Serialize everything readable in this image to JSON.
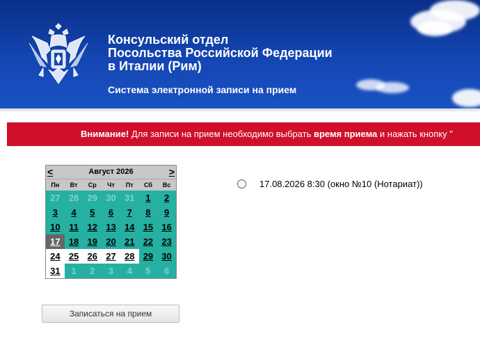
{
  "header": {
    "title_lines": [
      "Консульский отдел",
      "Посольства Российской Федерации",
      "в Италии (Рим)"
    ],
    "subtitle": "Система электронной записи на прием",
    "emblem_icon": "russian-coat-of-arms-icon"
  },
  "alert": {
    "bold_start": "Внимание!",
    "text1": " Для записи на прием необходимо выбрать ",
    "bold_mid": "время приема",
    "text2": " и нажать кнопку \""
  },
  "calendar": {
    "prev": "<",
    "next": ">",
    "month_title": "Август 2026",
    "weekdays": [
      "Пн",
      "Вт",
      "Ср",
      "Чт",
      "Пт",
      "Сб",
      "Вс"
    ],
    "days": [
      {
        "n": "27",
        "s": "dim"
      },
      {
        "n": "28",
        "s": "dim"
      },
      {
        "n": "29",
        "s": "dim"
      },
      {
        "n": "30",
        "s": "dim"
      },
      {
        "n": "31",
        "s": "dim"
      },
      {
        "n": "1",
        "s": "act"
      },
      {
        "n": "2",
        "s": "act"
      },
      {
        "n": "3",
        "s": "act"
      },
      {
        "n": "4",
        "s": "act"
      },
      {
        "n": "5",
        "s": "act"
      },
      {
        "n": "6",
        "s": "act"
      },
      {
        "n": "7",
        "s": "act"
      },
      {
        "n": "8",
        "s": "act"
      },
      {
        "n": "9",
        "s": "act"
      },
      {
        "n": "10",
        "s": "act"
      },
      {
        "n": "11",
        "s": "act"
      },
      {
        "n": "12",
        "s": "act"
      },
      {
        "n": "13",
        "s": "act"
      },
      {
        "n": "14",
        "s": "act"
      },
      {
        "n": "15",
        "s": "act"
      },
      {
        "n": "16",
        "s": "act"
      },
      {
        "n": "17",
        "s": "sel"
      },
      {
        "n": "18",
        "s": "act"
      },
      {
        "n": "19",
        "s": "act"
      },
      {
        "n": "20",
        "s": "act"
      },
      {
        "n": "21",
        "s": "act"
      },
      {
        "n": "22",
        "s": "act"
      },
      {
        "n": "23",
        "s": "act"
      },
      {
        "n": "24",
        "s": "white"
      },
      {
        "n": "25",
        "s": "white"
      },
      {
        "n": "26",
        "s": "white"
      },
      {
        "n": "27",
        "s": "white"
      },
      {
        "n": "28",
        "s": "white"
      },
      {
        "n": "29",
        "s": "act"
      },
      {
        "n": "30",
        "s": "act"
      },
      {
        "n": "31",
        "s": "white"
      },
      {
        "n": "1",
        "s": "dim"
      },
      {
        "n": "2",
        "s": "dim"
      },
      {
        "n": "3",
        "s": "dim"
      },
      {
        "n": "4",
        "s": "dim"
      },
      {
        "n": "5",
        "s": "dim"
      },
      {
        "n": "6",
        "s": "dim"
      }
    ]
  },
  "slot": {
    "label": "17.08.2026 8:30 (окно №10 (Нотариат))"
  },
  "button": {
    "label": "Записаться на прием"
  }
}
